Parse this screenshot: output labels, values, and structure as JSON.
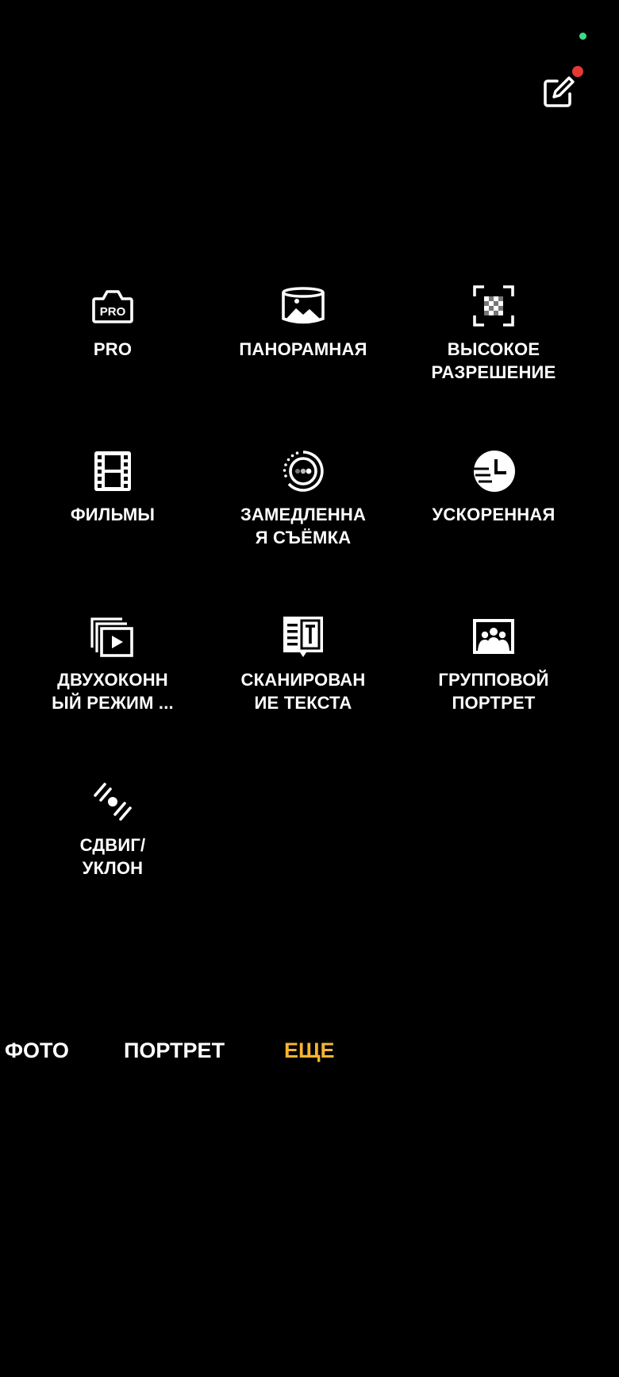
{
  "status": {
    "indicator_color": "#3ddc84"
  },
  "header": {
    "edit_icon": "edit-icon",
    "badge_color": "#e53935"
  },
  "modes": [
    {
      "label": "PRO",
      "icon": "pro-camera-icon"
    },
    {
      "label": "ПАНОРАМНАЯ",
      "icon": "panorama-icon"
    },
    {
      "label": "ВЫСОКОЕ\nРАЗРЕШЕНИЕ",
      "icon": "high-resolution-icon"
    },
    {
      "label": "ФИЛЬМЫ",
      "icon": "film-icon"
    },
    {
      "label": "ЗАМЕДЛЕННА\nЯ СЪЁМКА",
      "icon": "slow-motion-icon"
    },
    {
      "label": "УСКОРЕННАЯ",
      "icon": "time-lapse-icon"
    },
    {
      "label": "ДВУХОКОНН\nЫЙ РЕЖИМ ...",
      "icon": "dual-window-icon"
    },
    {
      "label": "СКАНИРОВАН\nИЕ ТЕКСТА",
      "icon": "text-scan-icon"
    },
    {
      "label": "ГРУППОВОЙ\nПОРТРЕТ",
      "icon": "group-portrait-icon"
    },
    {
      "label": "СДВИГ/\nУКЛОН",
      "icon": "tilt-shift-icon"
    }
  ],
  "tabs": {
    "photo": "ФОТО",
    "portrait": "ПОРТРЕТ",
    "more": "ЕЩЕ",
    "active_color": "#f5b531"
  }
}
